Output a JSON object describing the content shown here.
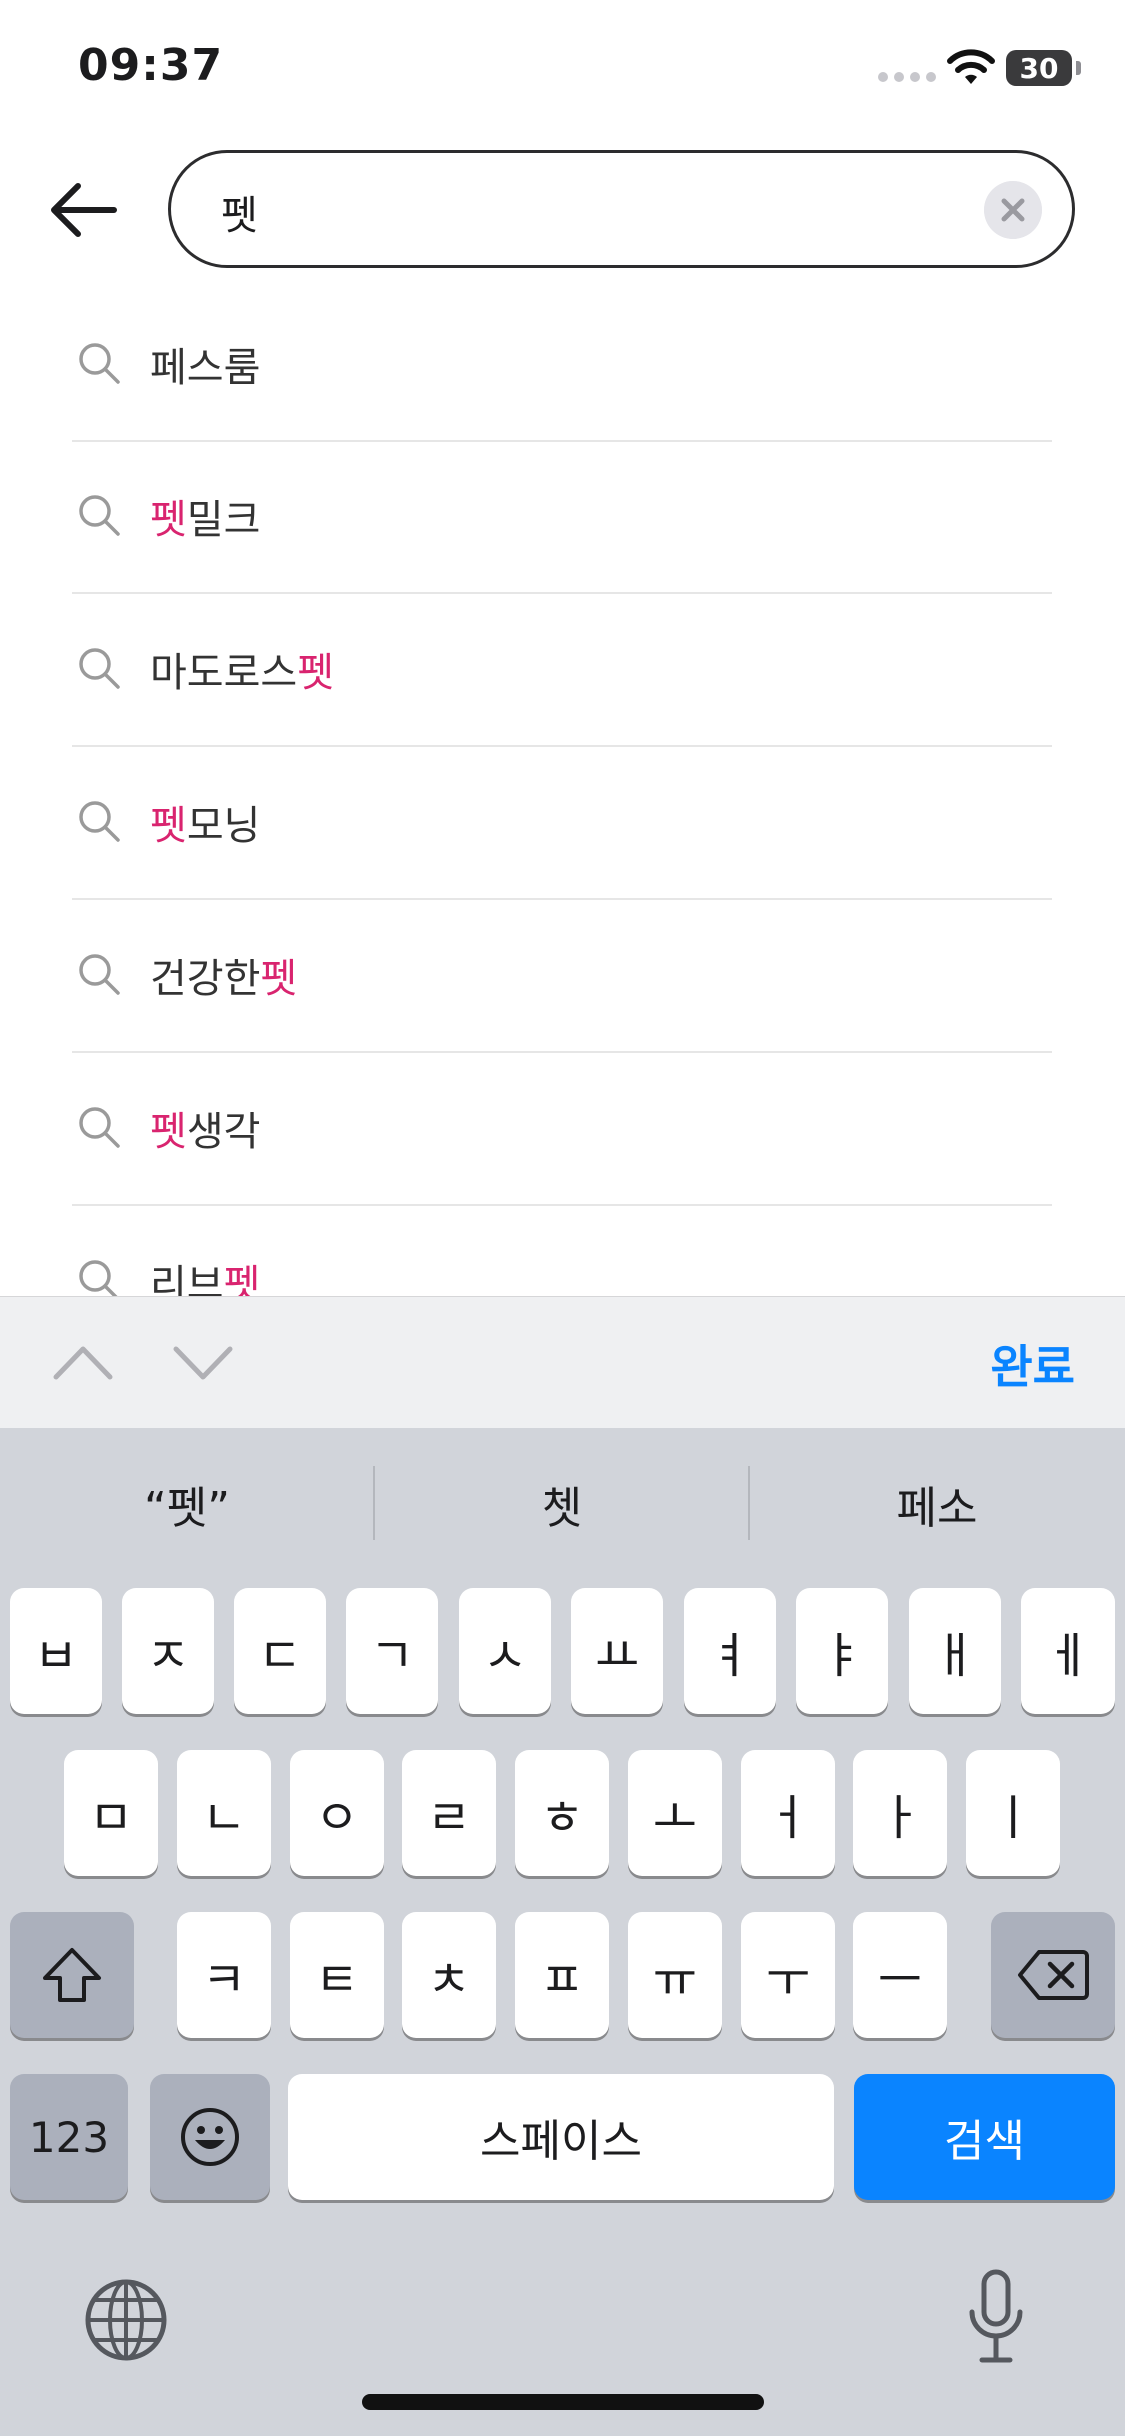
{
  "status_bar": {
    "time": "09:37",
    "battery": "30"
  },
  "search": {
    "value": "펫"
  },
  "suggestions": [
    {
      "before": "페스룸",
      "highlight": "",
      "after": ""
    },
    {
      "before": "",
      "highlight": "펫",
      "after": "밀크"
    },
    {
      "before": "마도로스",
      "highlight": "펫",
      "after": ""
    },
    {
      "before": "",
      "highlight": "펫",
      "after": "모닝"
    },
    {
      "before": "건강한",
      "highlight": "펫",
      "after": ""
    },
    {
      "before": "",
      "highlight": "펫",
      "after": "생각"
    },
    {
      "before": "리브",
      "highlight": "펫",
      "after": ""
    }
  ],
  "accessory": {
    "done_label": "완료"
  },
  "keyboard": {
    "predictions": [
      "“펫”",
      "쳇",
      "페소"
    ],
    "row1": [
      "ㅂ",
      "ㅈ",
      "ㄷ",
      "ㄱ",
      "ㅅ",
      "ㅛ",
      "ㅕ",
      "ㅑ",
      "ㅐ",
      "ㅔ"
    ],
    "row2": [
      "ㅁ",
      "ㄴ",
      "ㅇ",
      "ㄹ",
      "ㅎ",
      "ㅗ",
      "ㅓ",
      "ㅏ",
      "ㅣ"
    ],
    "row3": [
      "ㅋ",
      "ㅌ",
      "ㅊ",
      "ㅍ",
      "ㅠ",
      "ㅜ",
      "ㅡ"
    ],
    "numbers_label": "123",
    "space_label": "스페이스",
    "search_label": "검색"
  },
  "colors": {
    "highlight": "#d9246f",
    "accent": "#0a84ff",
    "keyboard_bg": "#d1d4da"
  },
  "icons": [
    "back-arrow-icon",
    "clear-icon",
    "search-icon",
    "chevron-up-icon",
    "chevron-down-icon",
    "shift-icon",
    "delete-icon",
    "emoji-icon",
    "globe-icon",
    "microphone-icon",
    "wifi-icon",
    "battery-icon"
  ]
}
